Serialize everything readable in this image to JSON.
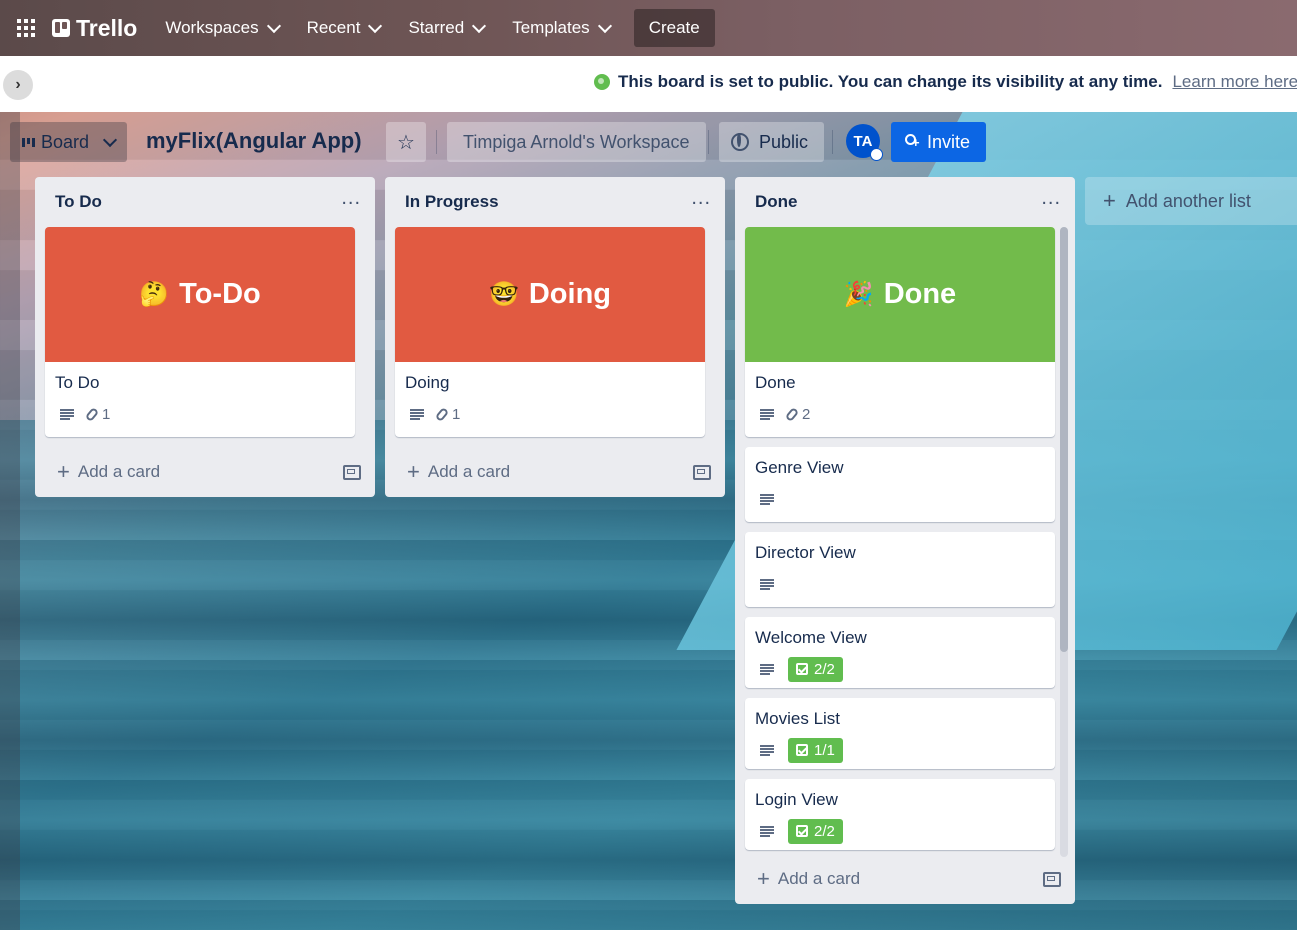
{
  "topnav": {
    "logo": "Trello",
    "menus": [
      {
        "label": "Workspaces"
      },
      {
        "label": "Recent"
      },
      {
        "label": "Starred"
      },
      {
        "label": "Templates"
      }
    ],
    "create_label": "Create"
  },
  "banner": {
    "text": "This board is set to public. You can change its visibility at any time.",
    "link": "Learn more here"
  },
  "board": {
    "view_label": "Board",
    "title": "myFlix(Angular App)",
    "workspace": "Timpiga Arnold's Workspace",
    "visibility": "Public",
    "avatar_initials": "TA",
    "invite_label": "Invite"
  },
  "lists": [
    {
      "title": "To Do",
      "add_card": "Add a card",
      "cards": [
        {
          "cover_text": "To-Do",
          "cover_emoji": "🤔",
          "cover_color": "#e15a41",
          "title": "To Do",
          "attachments": "1"
        }
      ]
    },
    {
      "title": "In Progress",
      "add_card": "Add a card",
      "cards": [
        {
          "cover_text": "Doing",
          "cover_emoji": "🤓",
          "cover_color": "#e15a41",
          "title": "Doing",
          "attachments": "1"
        }
      ]
    },
    {
      "title": "Done",
      "add_card": "Add a card",
      "cards": [
        {
          "cover_text": "Done",
          "cover_emoji": "🎉",
          "cover_color": "#72bb4b",
          "title": "Done",
          "attachments": "2"
        },
        {
          "title": "Genre View"
        },
        {
          "title": "Director View"
        },
        {
          "title": "Welcome View",
          "checklist": "2/2"
        },
        {
          "title": "Movies List",
          "checklist": "1/1"
        },
        {
          "title": "Login View",
          "checklist": "2/2"
        }
      ]
    }
  ],
  "add_list_label": "Add another list",
  "colors": {
    "accent": "#0c66e4",
    "checklist_complete": "#61bd4f"
  }
}
